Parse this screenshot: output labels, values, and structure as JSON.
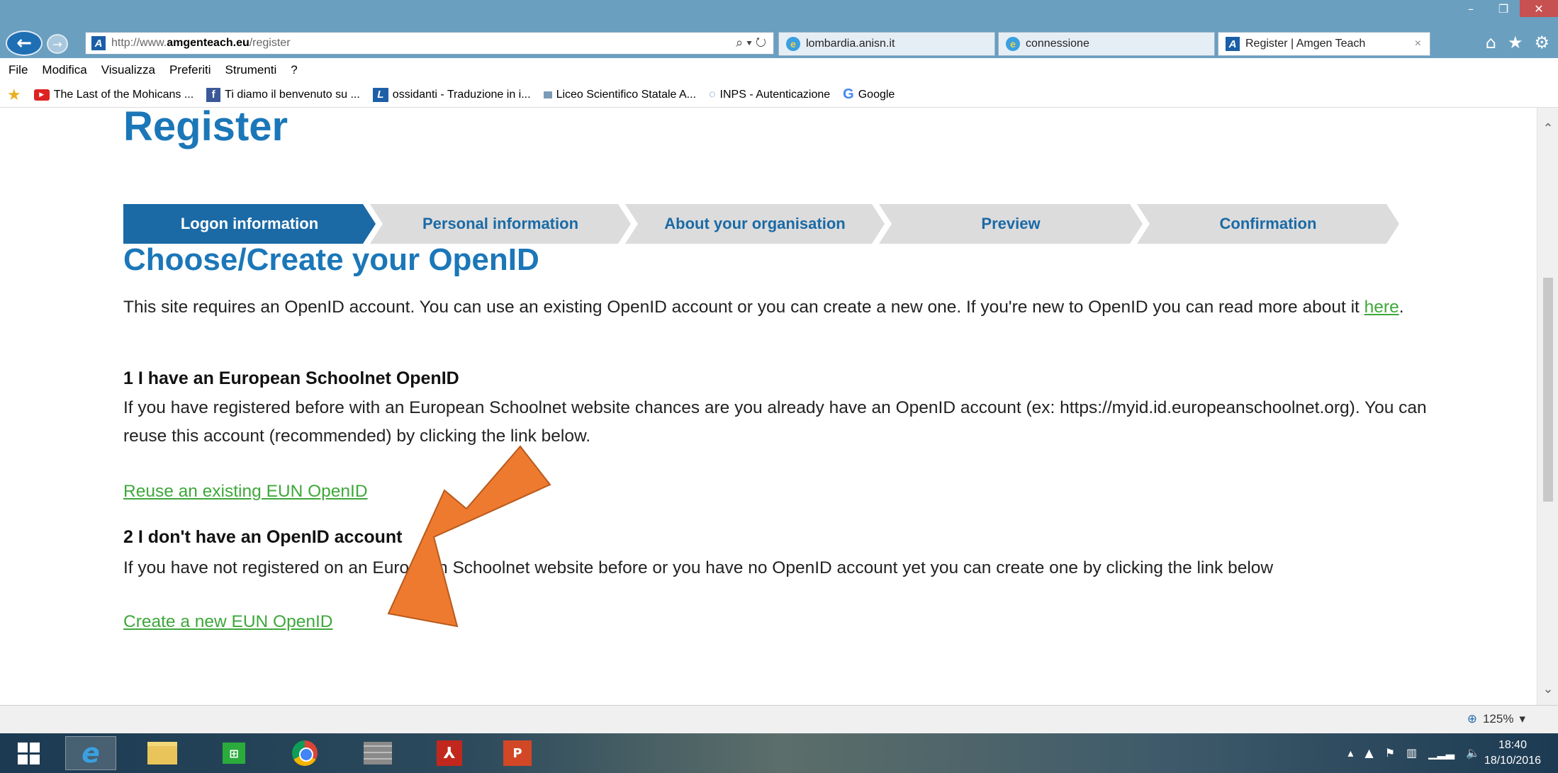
{
  "window": {
    "min": "–",
    "max": "❐",
    "close": "✕"
  },
  "nav": {
    "back": "←",
    "forward": "→",
    "url_prefix": "http://www.",
    "url_host": "amgenteach.eu",
    "url_path": "/register",
    "addr_actions": "⌕ ▾ ↻"
  },
  "tabs": [
    {
      "label": "lombardia.anisn.it"
    },
    {
      "label": "connessione"
    },
    {
      "label": "Register | Amgen Teach",
      "close": "×"
    }
  ],
  "nav_icons": {
    "home": "⌂",
    "star": "★",
    "gear": "⚙"
  },
  "menu": [
    "File",
    "Modifica",
    "Visualizza",
    "Preferiti",
    "Strumenti",
    "?"
  ],
  "favorites": [
    {
      "label": "The Last of the Mohicans ..."
    },
    {
      "label": "Ti diamo il benvenuto su ..."
    },
    {
      "label": "ossidanti - Traduzione in i..."
    },
    {
      "label": "Liceo Scientifico Statale A..."
    },
    {
      "label": "INPS - Autenticazione"
    },
    {
      "label": "Google"
    }
  ],
  "page": {
    "title": "Register",
    "steps": [
      {
        "label": "Logon information",
        "active": true
      },
      {
        "label": "Personal information",
        "active": false
      },
      {
        "label": "About your organisation",
        "active": false
      },
      {
        "label": "Preview",
        "active": false
      },
      {
        "label": "Confirmation",
        "active": false
      }
    ],
    "heading": "Choose/Create your OpenID",
    "intro_1": "This site requires an OpenID account. You can use an existing OpenID account or you can create a new one. If you're new to OpenID you can read more about it ",
    "intro_link": "here",
    "intro_end": ".",
    "section1_title": "1 I have an European Schoolnet OpenID",
    "section1_text": "If you have registered before with an European Schoolnet website chances are you already have an OpenID account (ex: https://myid.id.europeanschoolnet.org). You can reuse this account (recommended) by clicking the link below.",
    "section1_link": "Reuse an existing EUN OpenID",
    "section2_title": "2 I don't have an OpenID account",
    "section2_text": "If you have not registered on an European Schoolnet website before or you have no OpenID account yet you can create one by clicking the link below",
    "section2_link": "Create a new EUN OpenID"
  },
  "colors": {
    "brand_blue": "#1b77b8",
    "step_active": "#1b6aa5",
    "link_green": "#3ea83a",
    "arrow_orange": "#ee7a30"
  },
  "status": {
    "zoom": "125%"
  },
  "clock": {
    "time": "18:40",
    "date": "18/10/2016"
  }
}
